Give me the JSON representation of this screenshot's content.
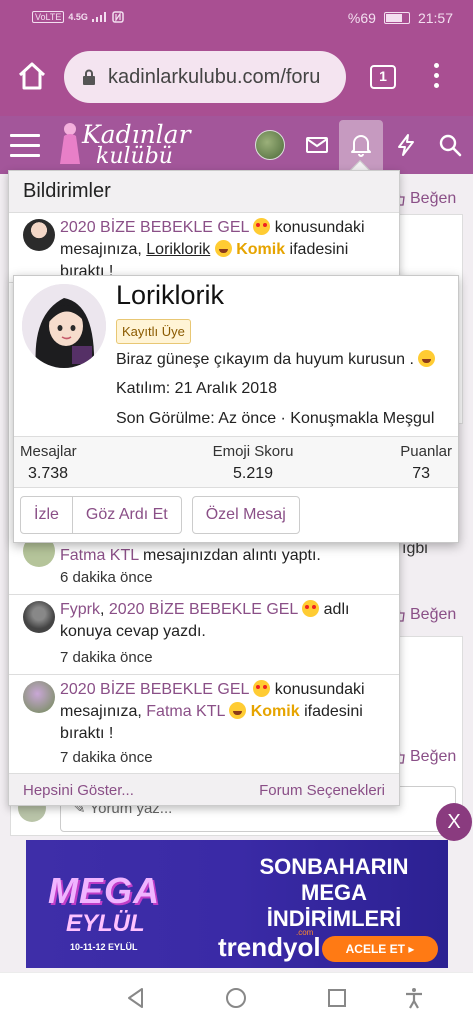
{
  "status_bar": {
    "network": [
      "VoLTE",
      "4.5G"
    ],
    "battery": "%69",
    "time": "21:57"
  },
  "browser": {
    "url": "kadinlarkulubu.com/foru",
    "tab_count": "1"
  },
  "site_header": {
    "logo_line1": "Kadınlar",
    "logo_line2": "kulübü"
  },
  "background": {
    "like_label": "Beğen",
    "partial_text": "ıgbi",
    "comment_placeholder": "Yorum yaz..."
  },
  "notifications": {
    "title": "Bildirimler",
    "items": [
      {
        "link_title": "2020 BİZE BEBEKLE GEL",
        "text1": " konusundaki mesajınıza, ",
        "user": "Loriklorik",
        "reaction": "Komik",
        "text2": " ifadesini bıraktı !",
        "time": ""
      },
      {
        "user": "Fatma KTL",
        "text": " mesajınızdan alıntı yaptı.",
        "time": "6 dakika önce"
      },
      {
        "user": "Fyprk",
        "sep": ", ",
        "link_title": "2020 BİZE BEBEKLE GEL",
        "text": " adlı konuya cevap yazdı.",
        "time": "7 dakika önce"
      },
      {
        "link_title": "2020 BİZE BEBEKLE GEL",
        "text1": " konusundaki mesajınıza, ",
        "user": "Fatma KTL",
        "reaction": "Komik",
        "text2": " ifadesini bıraktı !",
        "time": "7 dakika önce"
      }
    ],
    "footer_left": "Hepsini Göster...",
    "footer_right": "Forum Seçenekleri"
  },
  "member_card": {
    "name": "Loriklorik",
    "badge": "Kayıtlı Üye",
    "status": "Biraz güneşe çıkayım da huyum kurusun .",
    "joined": "Katılım: 21 Aralık 2018",
    "last_seen": "Son Görülme: Az önce · Konuşmakla Meşgul",
    "stats": [
      {
        "label": "Mesajlar",
        "value": "3.738"
      },
      {
        "label": "Emoji Skoru",
        "value": "5.219"
      },
      {
        "label": "Puanlar",
        "value": "73"
      }
    ],
    "buttons": {
      "follow": "İzle",
      "ignore": "Göz Ardı Et",
      "message": "Özel Mesaj"
    }
  },
  "close_label": "X",
  "banner": {
    "mega": "MEGA",
    "eylul": "EYLÜL",
    "dates": "10-11-12 EYLÜL",
    "headline1": "SONBAHARIN",
    "headline2": "MEGA",
    "headline3": "İNDİRİMLERİ",
    "brand": "trendyol",
    "brand_suffix": ".com",
    "cta": "ACELE ET ▸"
  },
  "colors": {
    "brand": "#a3569a",
    "link": "#8a4f87",
    "reaction": "#e6a400"
  }
}
